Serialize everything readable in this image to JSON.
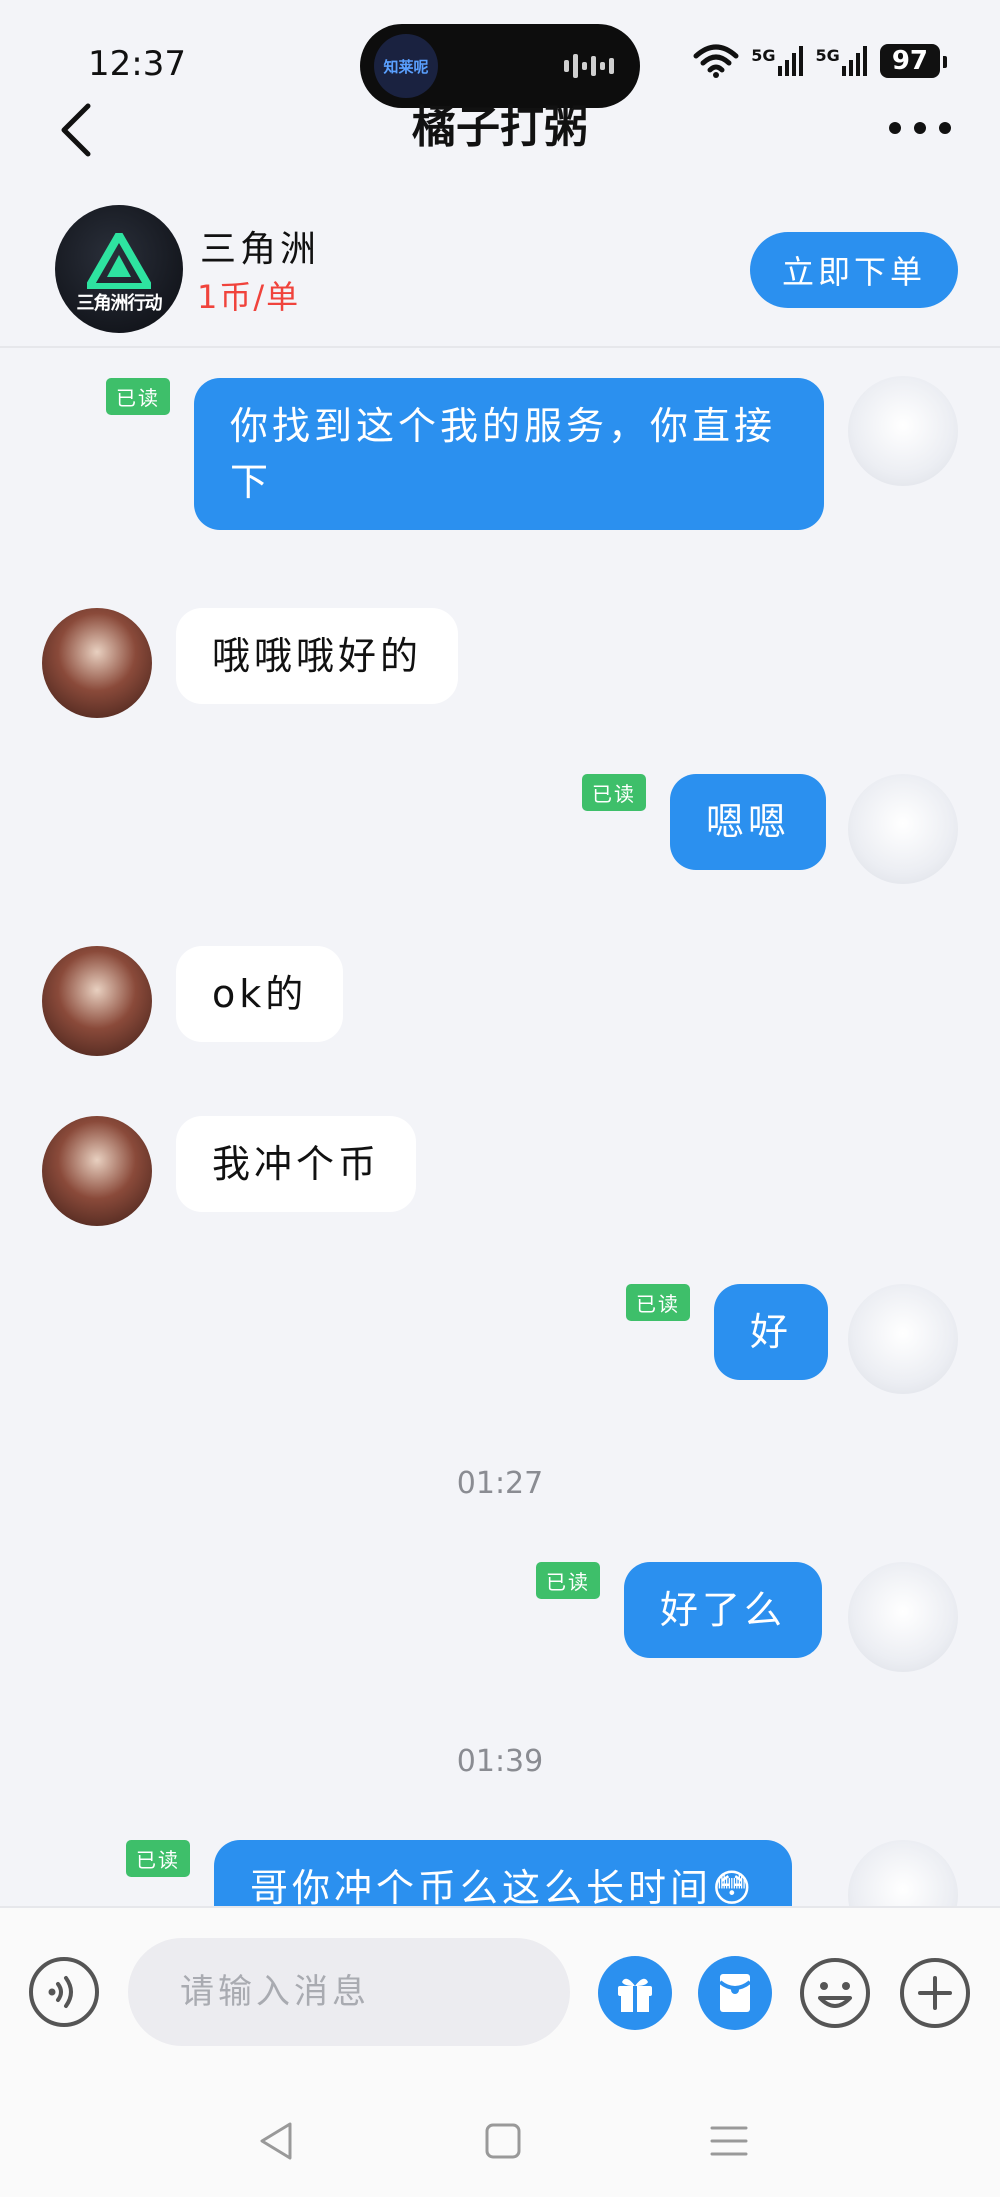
{
  "status_bar": {
    "time": "12:37",
    "island_app_label": "知莱呢",
    "network_1": "5G",
    "network_2": "5G",
    "battery": "97"
  },
  "header": {
    "title": "橘子打粥",
    "back_icon": "chevron-left-icon",
    "more_icon": "more-dots-icon"
  },
  "service": {
    "logo_text": "三角洲行动",
    "name": "三角洲",
    "price": "1币/单",
    "order_button": "立即下单"
  },
  "messages": [
    {
      "type": "out",
      "text": "你找到这个我的服务，你直接下",
      "read": "已读"
    },
    {
      "type": "in",
      "text": "哦哦哦好的"
    },
    {
      "type": "out",
      "text": "嗯嗯",
      "read": "已读"
    },
    {
      "type": "in",
      "text": "ok的"
    },
    {
      "type": "in",
      "text": "我冲个币"
    },
    {
      "type": "out",
      "text": "好",
      "read": "已读"
    },
    {
      "type": "time",
      "text": "01:27"
    },
    {
      "type": "out",
      "text": "好了么",
      "read": "已读"
    },
    {
      "type": "time",
      "text": "01:39"
    },
    {
      "type": "out",
      "text": "哥你冲个币么这么长时间😳",
      "read": "已读"
    }
  ],
  "input_bar": {
    "placeholder": "请输入消息",
    "voice_icon": "voice-icon",
    "gift_icon": "gift-icon",
    "red_packet_icon": "red-packet-icon",
    "emoji_icon": "emoji-icon",
    "plus_icon": "plus-icon"
  },
  "colors": {
    "accent": "#2b90ef",
    "read_badge": "#3ebf6a",
    "price": "#f0433c",
    "background": "#f3f4f8"
  }
}
